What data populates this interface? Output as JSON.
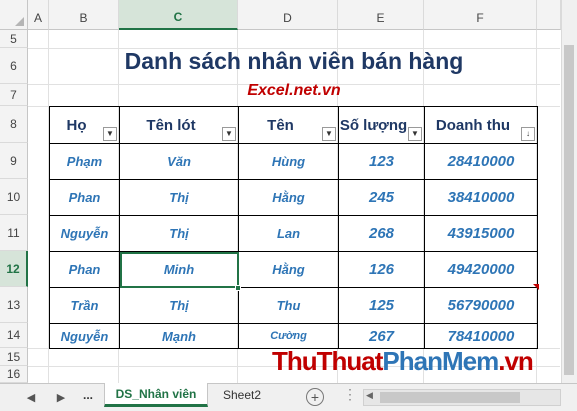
{
  "columns": [
    "A",
    "B",
    "C",
    "D",
    "E",
    "F"
  ],
  "rows": [
    "5",
    "6",
    "7",
    "8",
    "9",
    "10",
    "11",
    "12",
    "13",
    "14",
    "15",
    "16"
  ],
  "sheet_title": "Danh sách nhân viên bán hàng",
  "subtitle": "Excel.net.vn",
  "table": {
    "headers": [
      "Họ",
      "Tên lót",
      "Tên",
      "Số lượng",
      "Doanh thu"
    ],
    "rows": [
      [
        "Phạm",
        "Văn",
        "Hùng",
        "123",
        "28410000"
      ],
      [
        "Phan",
        "Thị",
        "Hằng",
        "245",
        "38410000"
      ],
      [
        "Nguyễn",
        "Thị",
        "Lan",
        "268",
        "43915000"
      ],
      [
        "Phan",
        "Minh",
        "Hằng",
        "126",
        "49420000"
      ],
      [
        "Trần",
        "Thị",
        "Thu",
        "125",
        "56790000"
      ],
      [
        "Nguyễn",
        "Mạnh",
        "Cường",
        "267",
        "78410000"
      ]
    ]
  },
  "tabs": {
    "more": "...",
    "active": "DS_Nhân viên",
    "other": "Sheet2",
    "add": "+"
  },
  "watermark": {
    "part1": "ThuThuat",
    "part2": "PhanMem",
    "part3": ".vn"
  },
  "colors": {
    "accent": "#217346",
    "title": "#1f3864",
    "value": "#2e75b6",
    "subtitle": "#c00000"
  }
}
